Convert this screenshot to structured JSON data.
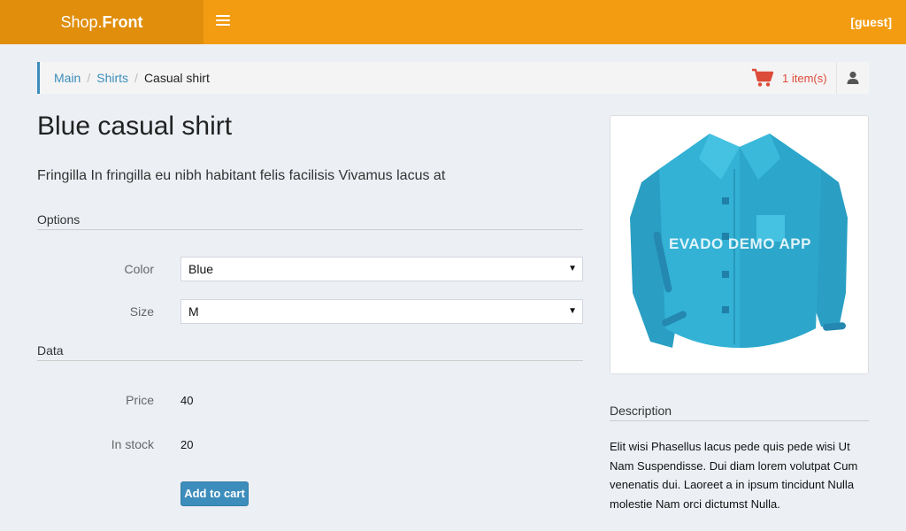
{
  "header": {
    "brand_prefix": "Shop.",
    "brand_bold": "Front",
    "user_label": "[guest]"
  },
  "breadcrumb": {
    "items": [
      "Main",
      "Shirts"
    ],
    "current": "Casual shirt",
    "separator": "/"
  },
  "cart": {
    "count_label": "1 item(s)"
  },
  "product": {
    "title": "Blue casual shirt",
    "summary": "Fringilla In fringilla eu nibh habitant felis facilisis Vivamus lacus at",
    "options_heading": "Options",
    "color_label": "Color",
    "color_value": "Blue",
    "size_label": "Size",
    "size_value": "M",
    "data_heading": "Data",
    "price_label": "Price",
    "price_value": "40",
    "stock_label": "In stock",
    "stock_value": "20",
    "add_button": "Add to cart",
    "image_watermark": "EVADO DEMO APP",
    "description_heading": "Description",
    "description": "Elit wisi Phasellus lacus pede quis pede wisi Ut Nam Suspendisse. Dui diam lorem volutpat Cum venenatis dui. Laoreet a in ipsum tincidunt Nulla molestie Nam orci dictumst Nulla."
  },
  "colors": {
    "topbar": "#f39c12",
    "brand_bg": "#e08e0b",
    "link": "#3c8dbc",
    "cart": "#dd4b39",
    "button": "#3c8dbc",
    "shirt": "#2ea9cc"
  },
  "icons": {
    "menu": "hamburger-icon",
    "cart": "shopping-cart-icon",
    "user": "user-icon"
  }
}
